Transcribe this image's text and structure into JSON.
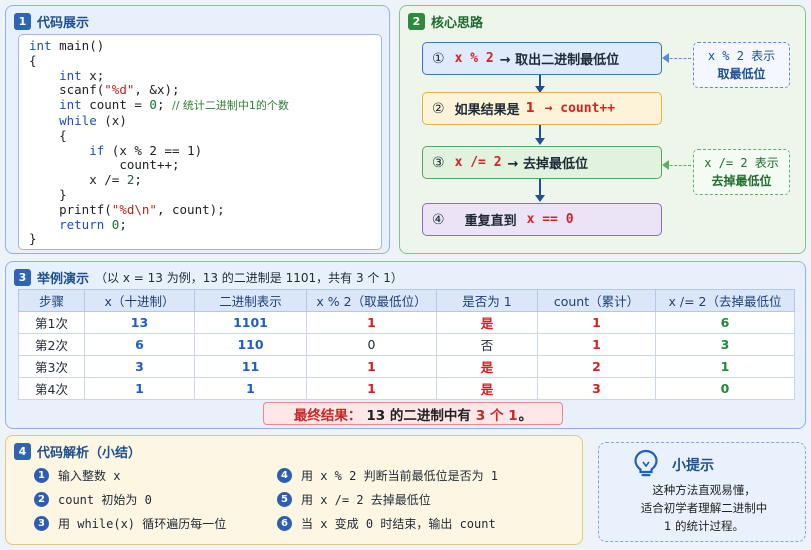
{
  "panel1": {
    "num": "1",
    "title": "代码展示",
    "code": {
      "l1_kw": "int",
      "l1_rest": " main()",
      "l2": "{",
      "l3_kw": "int",
      "l3_rest": " x;",
      "l4_a": "scanf(",
      "l4_str": "\"%d\"",
      "l4_b": ", &x);",
      "l5_kw": "int",
      "l5_a": " count = ",
      "l5_num": "0",
      "l5_b": "; ",
      "l5_cm": "// 统计二进制中1的个数",
      "l6_kw": "while",
      "l6_rest": " (x)",
      "l7": "{",
      "l8_kw": "if",
      "l8_rest": " (x % 2 == 1)",
      "l9": "count++;",
      "l10_a": "x /= ",
      "l10_num": "2",
      "l10_b": ";",
      "l11": "}",
      "l12_a": "printf(",
      "l12_str": "\"%d\\n\"",
      "l12_b": ", count);",
      "l13_kw": "return",
      "l13_num": "0",
      "l13_b": ";",
      "l14": "}"
    }
  },
  "panel2": {
    "num": "2",
    "title": "核心思路",
    "steps": [
      {
        "circle": "①",
        "code": "x % 2",
        "text": "→ 取出二进制最低位"
      },
      {
        "circle": "②",
        "text": "如果结果是",
        "val": "1",
        "code": "→ count++"
      },
      {
        "circle": "③",
        "code": "x /= 2",
        "text": "→ 去掉最低位"
      },
      {
        "circle": "④",
        "text": "重复直到",
        "code": "x == 0"
      }
    ],
    "note1": {
      "l1": "x % 2 表示",
      "l2": "取最低位"
    },
    "note2": {
      "l1": "x /= 2 表示",
      "l2": "去掉最低位"
    }
  },
  "panel3": {
    "num": "3",
    "title": "举例演示",
    "subtitle": "（以 x = 13 为例，13 的二进制是 1101，共有 3 个 1）",
    "headers": [
      "步骤",
      "x（十进制）",
      "二进制表示",
      "x % 2（取最低位）",
      "是否为 1",
      "count（累计）",
      "x /= 2（去掉最低位"
    ],
    "rows": [
      [
        "第1次",
        "13",
        "1101",
        "1",
        "是",
        "1",
        "6"
      ],
      [
        "第2次",
        "6",
        "110",
        "0",
        "否",
        "1",
        "3"
      ],
      [
        "第3次",
        "3",
        "11",
        "1",
        "是",
        "2",
        "1"
      ],
      [
        "第4次",
        "1",
        "1",
        "1",
        "是",
        "3",
        "0"
      ]
    ],
    "final": {
      "label": "最终结果：",
      "mid": "13 的二进制中有",
      "count": "3 个 1",
      "end": "。"
    }
  },
  "panel4": {
    "num": "4",
    "title": "代码解析（小结）",
    "items": [
      {
        "n": "1",
        "text": "输入整数 x"
      },
      {
        "n": "2",
        "text": "count 初始为 0"
      },
      {
        "n": "3",
        "text": "用 while(x) 循环遍历每一位"
      },
      {
        "n": "4",
        "text": "用 x % 2 判断当前最低位是否为 1"
      },
      {
        "n": "5",
        "text": "用 x /= 2 去掉最低位"
      },
      {
        "n": "6",
        "text": "当 x 变成 0 时结束，输出 count"
      }
    ]
  },
  "panel5": {
    "title": "小提示",
    "l1": "这种方法直观易懂，",
    "l2": "适合初学者理解二进制中",
    "l3": "1 的统计过程。"
  },
  "icons": {
    "tip": "lightbulb-icon"
  },
  "colors": {
    "blue": "#2f64b5",
    "green": "#2e8b3c",
    "red": "#d32222"
  }
}
